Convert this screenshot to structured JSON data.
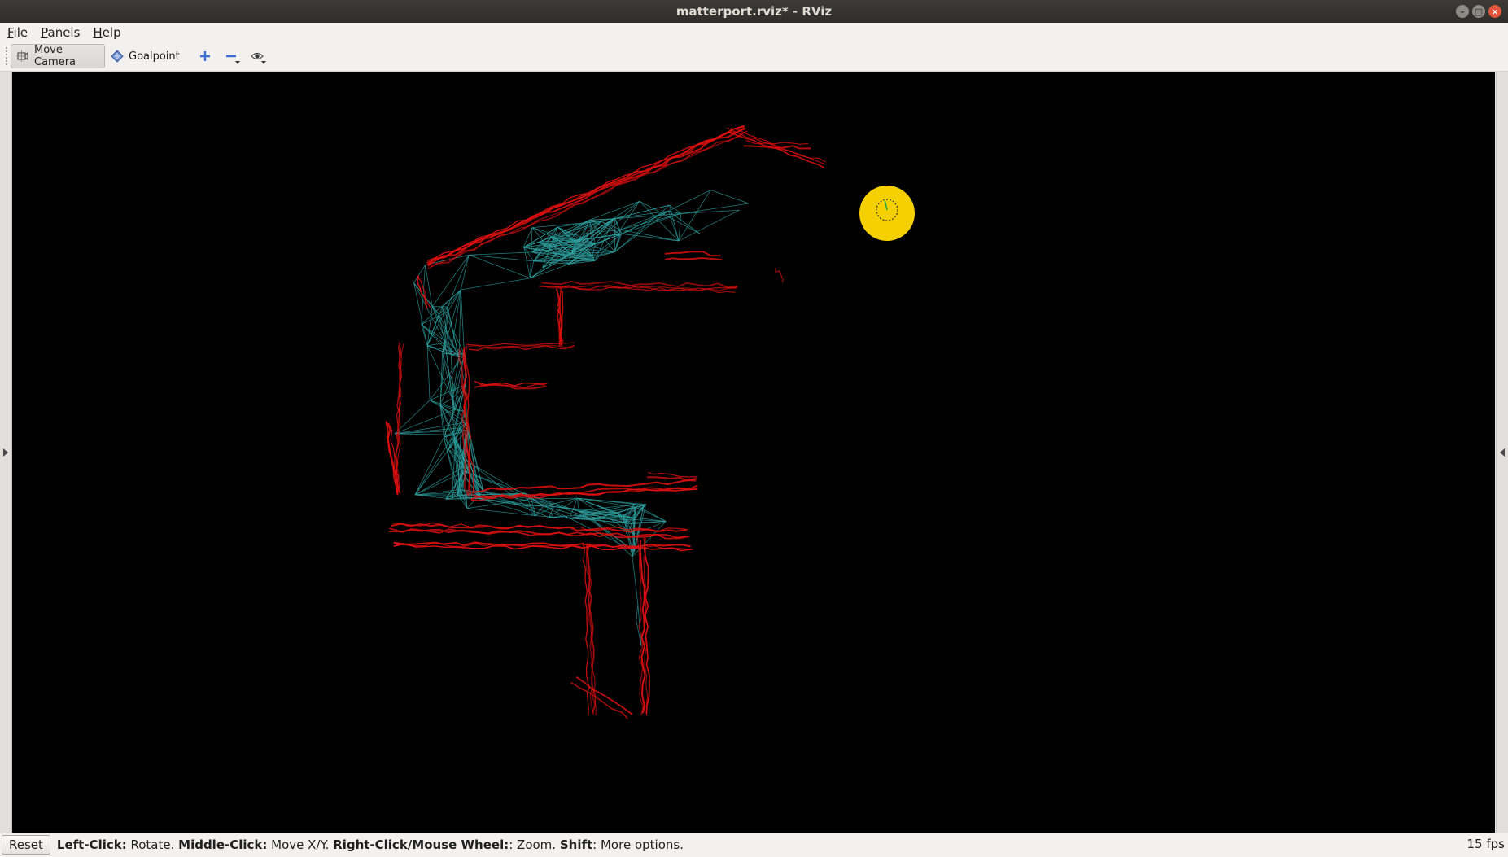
{
  "window": {
    "title": "matterport.rviz* - RViz"
  },
  "menu": {
    "items": [
      {
        "mnemonic": "F",
        "rest": "ile"
      },
      {
        "mnemonic": "P",
        "rest": "anels"
      },
      {
        "mnemonic": "H",
        "rest": "elp"
      }
    ]
  },
  "toolbar": {
    "move_camera": "Move Camera",
    "goalpoint": "Goalpoint"
  },
  "status": {
    "reset": "Reset",
    "hints": [
      {
        "key": "Left-Click:",
        "action": " Rotate. "
      },
      {
        "key": "Middle-Click:",
        "action": " Move X/Y. "
      },
      {
        "key": "Right-Click/Mouse Wheel:",
        "action": ": Zoom. "
      },
      {
        "key": "Shift",
        "action": ": More options."
      }
    ],
    "fps": "15 fps"
  },
  "colors": {
    "map": "#e01010",
    "graph": "#2fa0a0",
    "robot": "#f5d000",
    "viewport_bg": "#000000"
  }
}
